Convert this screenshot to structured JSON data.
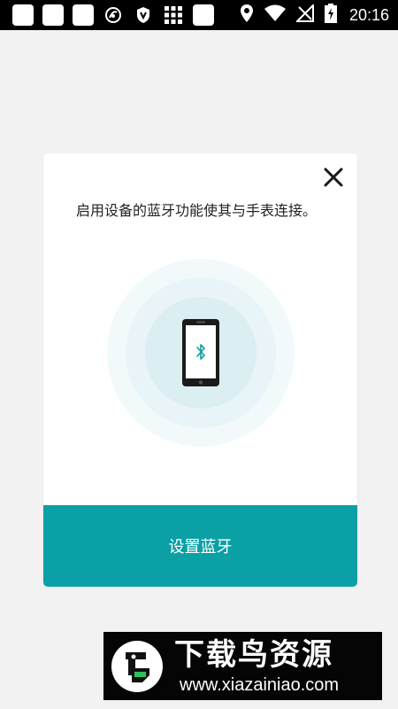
{
  "status_bar": {
    "time": "20:16",
    "left_icons": [
      "notification-square-icon",
      "notification-square-icon",
      "notification-square-icon",
      "signal-swirl-icon",
      "shield-v-icon",
      "grid-app-icon",
      "notification-square-icon"
    ],
    "right_icons": [
      "location-icon",
      "wifi-icon",
      "no-sim-icon",
      "battery-charging-icon"
    ]
  },
  "dialog": {
    "message": "启用设备的蓝牙功能使其与手表连接。",
    "close_icon": "close-icon",
    "illustration_icon": "phone-bluetooth-icon",
    "confirm_label": "设置蓝牙"
  },
  "watermark": {
    "title": "下载鸟资源",
    "url": "www.xiazainiao.com"
  },
  "colors": {
    "accent": "#0aa0a5",
    "ring_outer": "#f2f9fb",
    "ring_mid": "#e8f4f7",
    "ring_inner": "#dbeef2",
    "page_bg": "#f2f2f2"
  }
}
